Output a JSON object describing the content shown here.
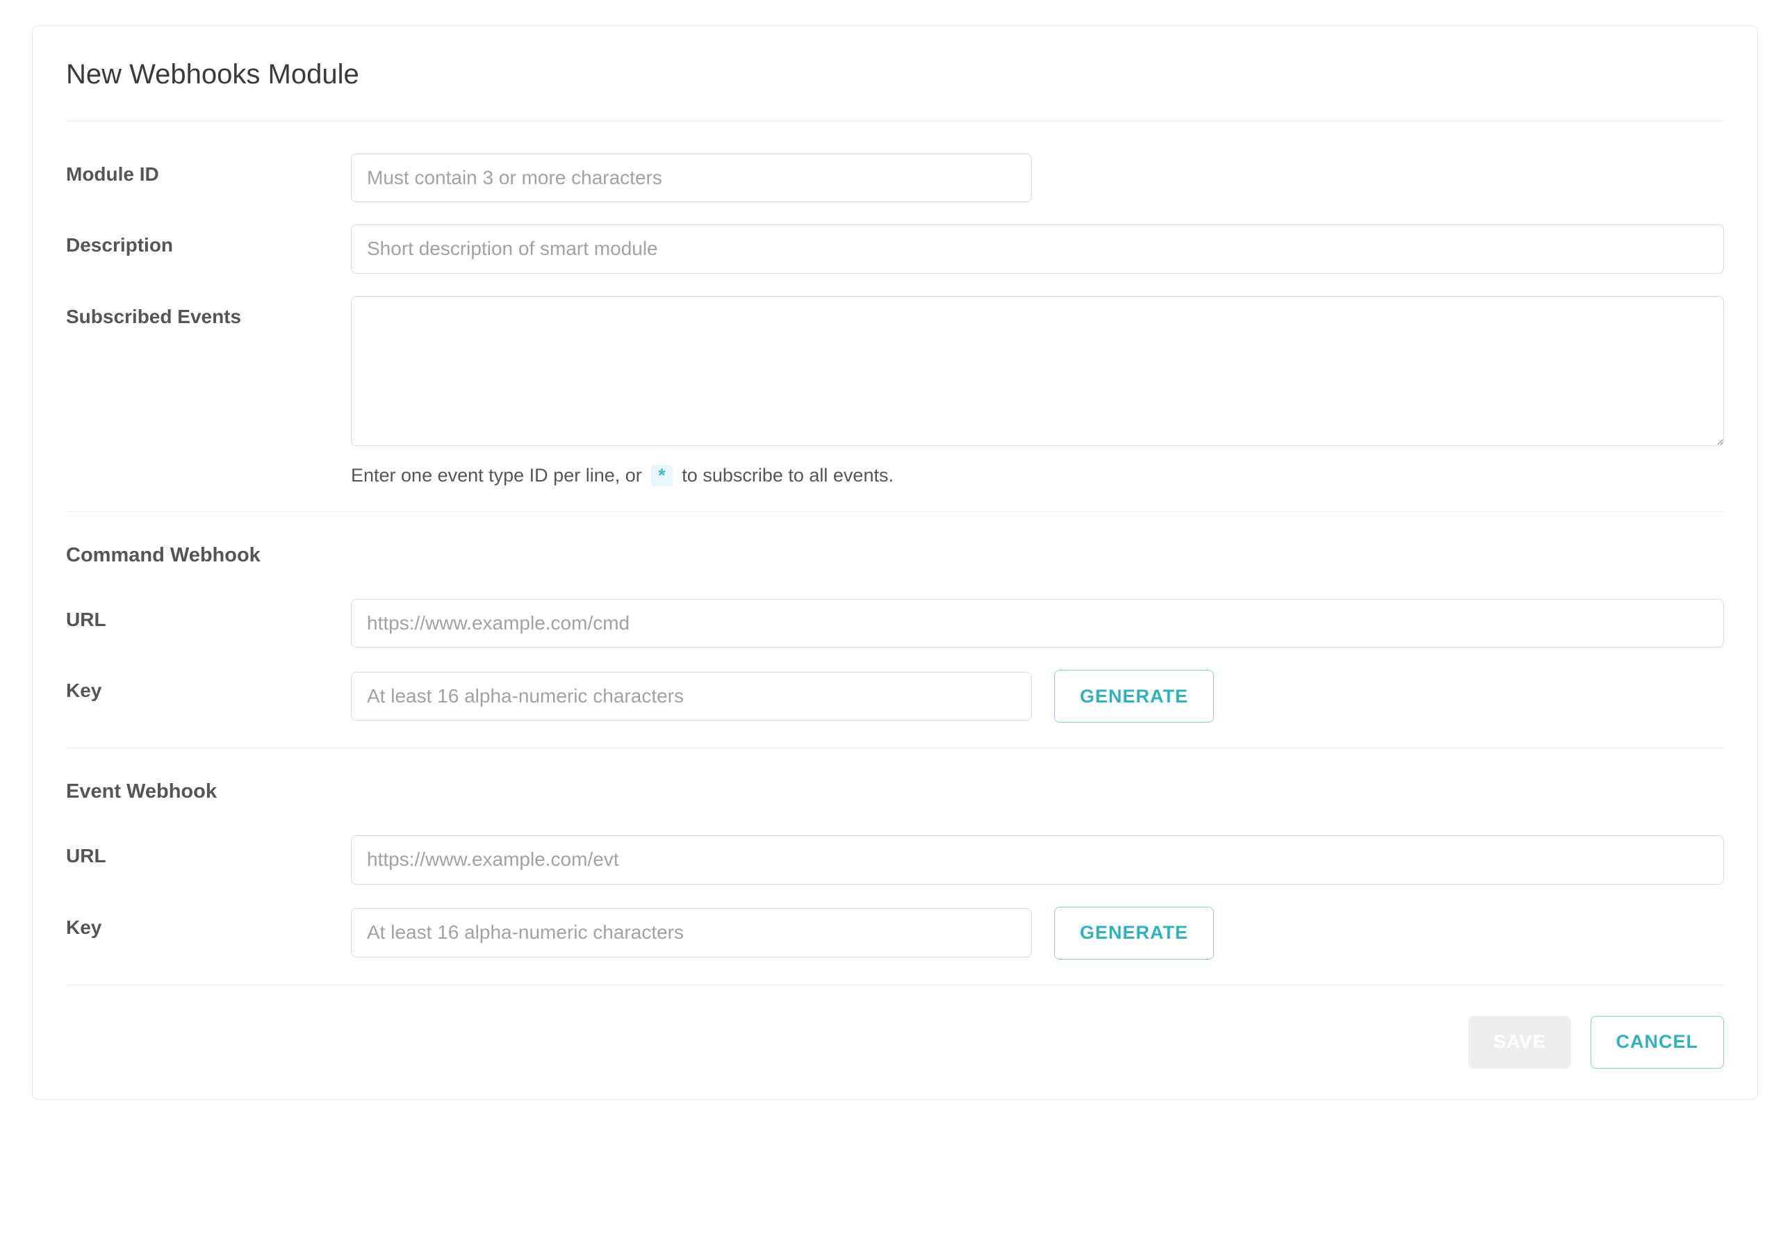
{
  "title": "New Webhooks Module",
  "general": {
    "module_id": {
      "label": "Module ID",
      "placeholder": "Must contain 3 or more characters",
      "value": ""
    },
    "description": {
      "label": "Description",
      "placeholder": "Short description of smart module",
      "value": ""
    },
    "subscribed_events": {
      "label": "Subscribed Events",
      "value": "",
      "helper_prefix": "Enter one event type ID per line, or",
      "helper_star": "*",
      "helper_suffix": "to subscribe to all events."
    }
  },
  "command_webhook": {
    "title": "Command Webhook",
    "url": {
      "label": "URL",
      "placeholder": "https://www.example.com/cmd",
      "value": ""
    },
    "key": {
      "label": "Key",
      "placeholder": "At least 16 alpha-numeric characters",
      "value": "",
      "generate_label": "GENERATE"
    }
  },
  "event_webhook": {
    "title": "Event Webhook",
    "url": {
      "label": "URL",
      "placeholder": "https://www.example.com/evt",
      "value": ""
    },
    "key": {
      "label": "Key",
      "placeholder": "At least 16 alpha-numeric characters",
      "value": "",
      "generate_label": "GENERATE"
    }
  },
  "footer": {
    "save_label": "SAVE",
    "cancel_label": "CANCEL"
  },
  "colors": {
    "accent": "#2db3bd",
    "accent_border": "#79d1d7",
    "disabled_bg": "#eceef0",
    "text": "#4a4a4a",
    "border": "#d6d9dc",
    "divider": "#e9ebed",
    "placeholder": "#9ea3a8",
    "chip_bg": "#e8f7f9",
    "chip_text": "#3fb9c6"
  }
}
